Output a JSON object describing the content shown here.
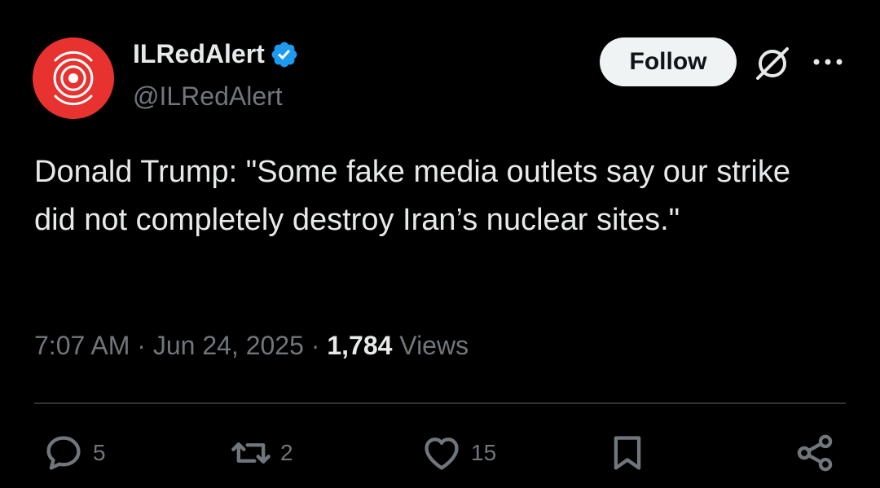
{
  "post": {
    "author": {
      "display_name": "ILRedAlert",
      "handle": "@ILRedAlert",
      "verified": true,
      "avatar_color": "#e8322f"
    },
    "follow_label": "Follow",
    "text": "Donald Trump: \"Some fake media outlets say our strike did not completely destroy Iran’s nuclear sites.\"",
    "time": "7:07 AM",
    "date": "Jun 24, 2025",
    "separator": "·",
    "views_count": "1,784",
    "views_label": "Views"
  },
  "actions": {
    "replies": "5",
    "reposts": "2",
    "likes": "15"
  },
  "colors": {
    "background": "#000000",
    "text": "#e7e9ea",
    "muted": "#71767b",
    "verified_blue": "#1d9bf0",
    "divider": "#2f3336"
  },
  "icons": [
    "verified-badge-icon",
    "grok-icon",
    "more-icon",
    "reply-icon",
    "repost-icon",
    "like-icon",
    "bookmark-icon",
    "share-icon"
  ]
}
